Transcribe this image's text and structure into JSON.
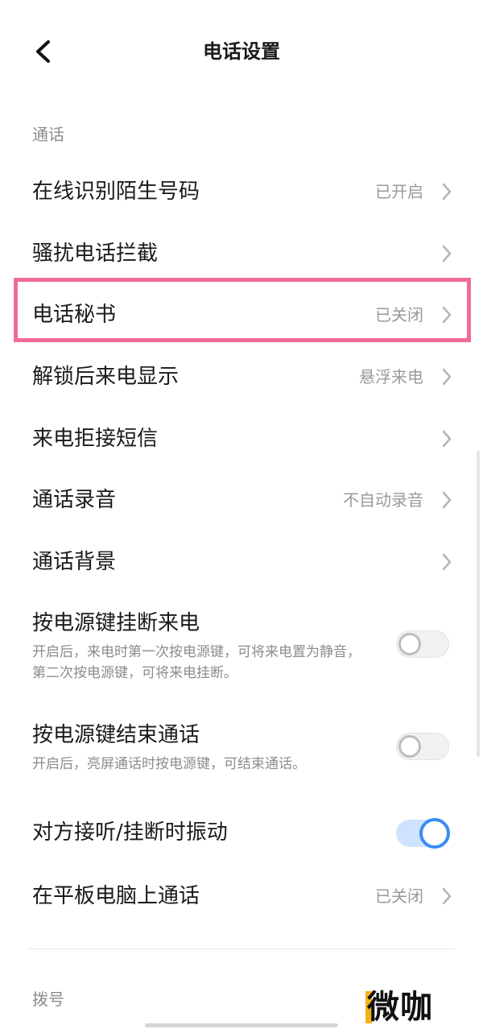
{
  "header": {
    "title": "电话设置",
    "back_icon": "chevron-left-icon"
  },
  "sections": {
    "call_label": "通话",
    "dial_label": "拨号"
  },
  "rows": {
    "caller_id": {
      "label": "在线识别陌生号码",
      "value": "已开启"
    },
    "block": {
      "label": "骚扰电话拦截",
      "value": ""
    },
    "secretary": {
      "label": "电话秘书",
      "value": "已关闭"
    },
    "unlock_display": {
      "label": "解锁后来电显示",
      "value": "悬浮来电"
    },
    "reject_sms": {
      "label": "来电拒接短信",
      "value": ""
    },
    "recording": {
      "label": "通话录音",
      "value": "不自动录音"
    },
    "background": {
      "label": "通话背景",
      "value": ""
    },
    "tablet_call": {
      "label": "在平板电脑上通话",
      "value": "已关闭"
    }
  },
  "toggles": {
    "power_hangup": {
      "label": "按电源键挂断来电",
      "desc": "开启后，来电时第一次按电源键，可将来电置为静音，第二次按电源键，可将来电挂断。",
      "on": false
    },
    "power_end": {
      "label": "按电源键结束通话",
      "desc": "开启后，亮屏通话时按电源键，可结束通话。",
      "on": false
    },
    "vibrate": {
      "label": "对方接听/挂断时振动",
      "on": true
    }
  },
  "watermark": {
    "text": "微咖"
  },
  "colors": {
    "accent": "#3b8cf5",
    "highlight": "#f06b97",
    "secondary_text": "#9a9a9a"
  }
}
